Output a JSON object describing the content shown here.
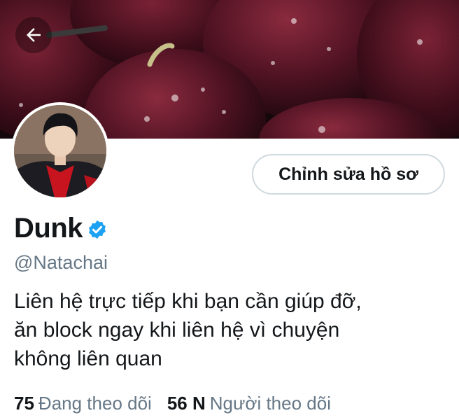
{
  "header": {
    "back_icon": "arrow-left-icon",
    "banner_description_colors": {
      "dark": "#1a0d12",
      "plum": "#5a1526"
    }
  },
  "profile": {
    "display_name": "Dunk",
    "verified": true,
    "verified_icon": "verified-badge-icon",
    "handle": "@Natachai",
    "bio_lines": [
      "Liên hệ trực tiếp khi bạn cần giúp đỡ,",
      "ăn block ngay khi liên hệ vì chuyện",
      "không liên quan"
    ]
  },
  "actions": {
    "edit_profile_label": "Chỉnh sửa hồ sơ"
  },
  "stats": {
    "following_count": "75",
    "following_label": "Đang theo dõi",
    "followers_count": "56 N",
    "followers_label": "Người theo dõi"
  },
  "colors": {
    "accent": "#1da1f2",
    "text_primary": "#14171a",
    "text_secondary": "#657786",
    "border": "#cfd9de"
  }
}
